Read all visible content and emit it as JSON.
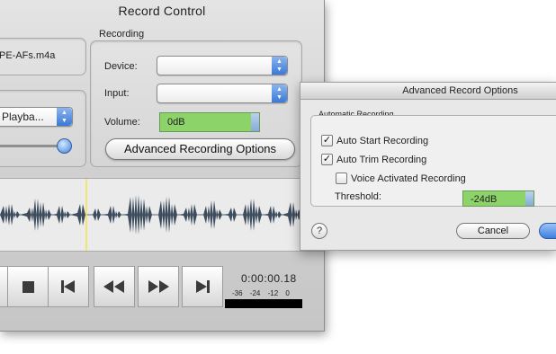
{
  "window": {
    "title": "Record Control",
    "file_name": "PE-AFs.m4a"
  },
  "recording": {
    "group_title": "Recording",
    "device_label": "Device:",
    "device_value": "",
    "input_label": "Input:",
    "input_value": "",
    "volume_label": "Volume:",
    "volume_value": "0dB",
    "advanced_button": "Advanced Recording Options"
  },
  "playback": {
    "popup_value": "Playba..."
  },
  "transport": {
    "time": "0:00:00.18",
    "meter_labels": [
      "-36",
      "-24",
      "-12",
      "0"
    ]
  },
  "dialog": {
    "title": "Advanced Record Options",
    "group_title": "Automatic Recording",
    "options": [
      {
        "label": "Auto Start Recording",
        "checked": true
      },
      {
        "label": "Auto Trim Recording",
        "checked": true
      },
      {
        "label": "Voice Activated Recording",
        "checked": false
      }
    ],
    "threshold_label": "Threshold:",
    "threshold_value": "-24dB",
    "cancel_label": "Cancel",
    "help_label": "?"
  },
  "colors": {
    "level_green": "#8cd36a",
    "playhead_yellow": "#f2e24a",
    "accent_blue": "#3d7fdc"
  }
}
